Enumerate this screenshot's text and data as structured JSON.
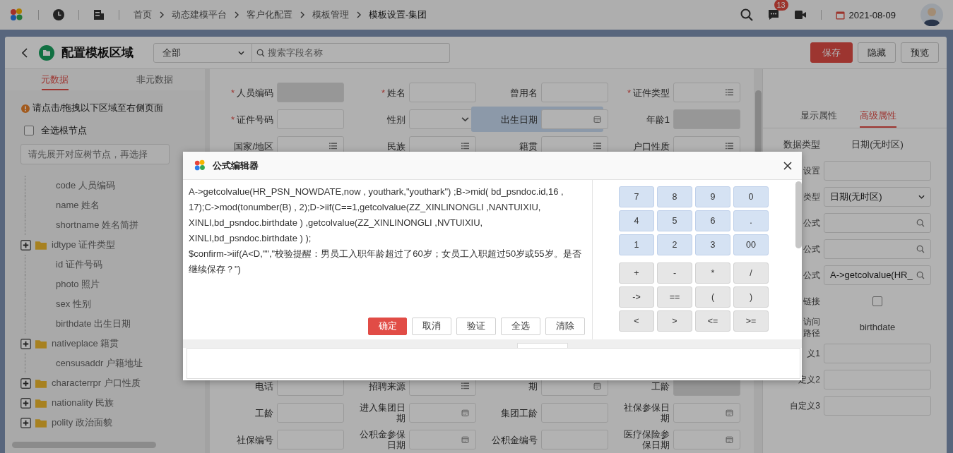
{
  "top_bar": {
    "breadcrumbs": [
      {
        "label": "首页",
        "current": false
      },
      {
        "label": "动态建模平台",
        "current": false
      },
      {
        "label": "客户化配置",
        "current": false
      },
      {
        "label": "模板管理",
        "current": false
      },
      {
        "label": "模板设置-集团",
        "current": true
      }
    ],
    "notification_count": "13",
    "date": "2021-08-09"
  },
  "header": {
    "title": "配置模板区域",
    "filter": "全部",
    "search": {
      "placeholder": "搜索字段名称"
    },
    "buttons": [
      {
        "label": "保存",
        "kind": "primary"
      },
      {
        "label": "隐藏",
        "kind": "default"
      },
      {
        "label": "预览",
        "kind": "default"
      }
    ]
  },
  "left_panel": {
    "tabs": [
      {
        "label": "元数据",
        "selected": true
      },
      {
        "label": "非元数据",
        "selected": false
      }
    ],
    "hint": "请点击/拖拽以下区域至右侧页面",
    "select_all": {
      "label": "全选根节点",
      "checked": false
    },
    "tree_search": {
      "placeholder": "请先展开对应树节点，再选择"
    },
    "tree": [
      {
        "label": "code 人员编码",
        "kind": "leaf"
      },
      {
        "label": "name 姓名",
        "kind": "leaf"
      },
      {
        "label": "shortname 姓名简拼",
        "kind": "leaf"
      },
      {
        "label": "idtype 证件类型",
        "kind": "folder"
      },
      {
        "label": "id 证件号码",
        "kind": "leaf"
      },
      {
        "label": "photo 照片",
        "kind": "leaf"
      },
      {
        "label": "sex 性别",
        "kind": "leaf"
      },
      {
        "label": "birthdate 出生日期",
        "kind": "leaf"
      },
      {
        "label": "nativeplace 籍贯",
        "kind": "folder"
      },
      {
        "label": "censusaddr 户籍地址",
        "kind": "leaf"
      },
      {
        "label": "characterrpr 户口性质",
        "kind": "folder"
      },
      {
        "label": "nationality 民族",
        "kind": "folder"
      },
      {
        "label": "polity 政治面貌",
        "kind": "folder"
      }
    ]
  },
  "form": {
    "upper_rows": [
      [
        {
          "label": "人员编码",
          "required": true,
          "kind": "text",
          "disabled": true,
          "selected": false
        },
        {
          "label": "姓名",
          "required": true,
          "kind": "text",
          "disabled": false,
          "selected": false
        },
        {
          "label": "曾用名",
          "required": false,
          "kind": "text",
          "disabled": false,
          "selected": false
        },
        {
          "label": "证件类型",
          "required": true,
          "kind": "list",
          "disabled": false,
          "selected": false
        }
      ],
      [
        {
          "label": "证件号码",
          "required": true,
          "kind": "text",
          "disabled": false,
          "selected": false
        },
        {
          "label": "性别",
          "required": false,
          "kind": "select",
          "disabled": false,
          "selected": false
        },
        {
          "label": "出生日期",
          "required": false,
          "kind": "date",
          "disabled": false,
          "selected": true
        },
        {
          "label": "年龄1",
          "required": false,
          "kind": "text",
          "disabled": true,
          "selected": false
        }
      ],
      [
        {
          "label": "国家/地区",
          "required": false,
          "kind": "list",
          "disabled": false,
          "selected": false
        },
        {
          "label": "民族",
          "required": false,
          "kind": "list",
          "disabled": false,
          "selected": false
        },
        {
          "label": "籍贯",
          "required": false,
          "kind": "list",
          "disabled": false,
          "selected": false
        },
        {
          "label": "户口性质",
          "required": false,
          "kind": "list",
          "disabled": false,
          "selected": false
        }
      ]
    ],
    "lower_rows": [
      [
        {
          "label": "电话",
          "required": false,
          "kind": "text",
          "disabled": false,
          "selected": false
        },
        {
          "label": "招聘来源",
          "required": false,
          "kind": "list",
          "disabled": false,
          "selected": false
        },
        {
          "label": "期",
          "required": false,
          "kind": "date",
          "disabled": false,
          "selected": false
        },
        {
          "label": "工龄",
          "required": false,
          "kind": "text",
          "disabled": true,
          "selected": false
        }
      ],
      [
        {
          "label": "工龄",
          "required": false,
          "kind": "text",
          "disabled": false,
          "selected": false
        },
        {
          "label": "进入集团日期",
          "required": false,
          "kind": "date",
          "disabled": false,
          "selected": false
        },
        {
          "label": "集团工龄",
          "required": false,
          "kind": "text",
          "disabled": false,
          "selected": false
        },
        {
          "label": "社保参保日期",
          "required": false,
          "kind": "date",
          "disabled": false,
          "selected": false
        }
      ],
      [
        {
          "label": "社保编号",
          "required": false,
          "kind": "text",
          "disabled": false,
          "selected": false
        },
        {
          "label": "公积金参保日期",
          "required": false,
          "kind": "date",
          "disabled": false,
          "selected": false
        },
        {
          "label": "公积金编号",
          "required": false,
          "kind": "text",
          "disabled": false,
          "selected": false
        },
        {
          "label": "医疗保险参保日期",
          "required": false,
          "kind": "date",
          "disabled": false,
          "selected": false
        }
      ]
    ]
  },
  "right_panel": {
    "tabs": [
      {
        "label": "显示属性",
        "selected": false
      },
      {
        "label": "高级属性",
        "selected": true
      }
    ],
    "data_type": {
      "label": "数据类型",
      "value": "日期(无时区)"
    },
    "properties": [
      {
        "label": "设置",
        "kind": "input"
      },
      {
        "label": "类型",
        "kind": "select",
        "value": "日期(无时区)"
      },
      {
        "label": "公式",
        "kind": "search"
      },
      {
        "label": "公式",
        "kind": "search"
      },
      {
        "label": "公式",
        "kind": "search",
        "value": "A->getcolvalue(HR_"
      },
      {
        "label": "链接",
        "kind": "checkbox",
        "checked": false
      },
      {
        "label": "访问路径",
        "kind": "text",
        "value": "birthdate"
      },
      {
        "label": "义1",
        "kind": "input"
      },
      {
        "label": "定义2",
        "kind": "input"
      },
      {
        "label": "自定义3",
        "kind": "input"
      }
    ]
  },
  "dialog": {
    "title": "公式编辑器",
    "formula": [
      "A->getcolvalue(HR_PSN_NOWDATE,now , youthark,\"youthark\") ;B->mid( bd_psndoc.id,16 , 17);C->mod(tonumber(B) , 2);D->iif(C==1,getcolvalue(ZZ_XINLINONGLI ,NANTUIXIU, XINLI,bd_psndoc.birthdate ) ,getcolvalue(ZZ_XINLINONGLI ,NVTUIXIU, XINLI,bd_psndoc.birthdate ) );",
      "$confirm->iif(A<D,\"\",\"校验提醒：男员工入职年龄超过了60岁；女员工入职超过50岁或55岁。是否继续保存？\")"
    ],
    "actions": [
      {
        "label": "确定",
        "kind": "primary"
      },
      {
        "label": "取消",
        "kind": "default"
      },
      {
        "label": "验证",
        "kind": "default"
      },
      {
        "label": "全选",
        "kind": "default"
      },
      {
        "label": "清除",
        "kind": "default"
      }
    ],
    "digit_keys": [
      "7",
      "8",
      "9",
      "0",
      "4",
      "5",
      "6",
      ".",
      "1",
      "2",
      "3",
      "00"
    ],
    "operator_keys": [
      "+",
      "-",
      "*",
      "/",
      "->",
      "==",
      "(",
      ")",
      "<",
      ">",
      "<=",
      ">="
    ]
  }
}
